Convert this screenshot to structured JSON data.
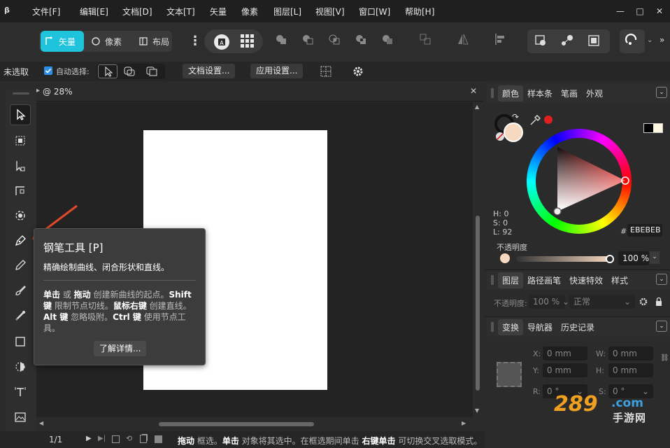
{
  "menubar": {
    "logo": "β",
    "items": [
      "文件[F]",
      "编辑[E]",
      "文档[D]",
      "文本[T]",
      "矢量",
      "像素",
      "图层[L]",
      "视图[V]",
      "窗口[W]",
      "帮助[H]"
    ],
    "minimize": "—",
    "maximize": "□",
    "close": "✕"
  },
  "toolbar": {
    "personas": {
      "vector": "矢量",
      "pixel": "像素",
      "layout": "布局"
    },
    "more": "⋮"
  },
  "contextbar": {
    "selection": "未选取",
    "auto_select_label": "自动选择:",
    "auto_select_checked": true,
    "doc_settings": "文档设置...",
    "app_settings": "应用设置..."
  },
  "document": {
    "tab_title": "@ 28%",
    "page_indicator": "1/1"
  },
  "tooltip": {
    "title": "钢笔工具 [P]",
    "subtitle": "精确绘制曲线、闭合形状和直线。",
    "line1_a": "单击",
    "line1_b": " 或 ",
    "line1_c": "拖动",
    "line1_d": " 创建新曲线的起点。",
    "line1_e": "Shift",
    "line2_a": "键",
    "line2_b": " 限制节点切线。",
    "line2_c": "鼠标右键",
    "line2_d": " 创建直线。",
    "line3_a": "Alt 键",
    "line3_b": " 忽略吸附。",
    "line3_c": "Ctrl 键",
    "line3_d": " 使用节点工",
    "line4": "具。",
    "learn_more": "了解详情..."
  },
  "color_panel": {
    "tabs": [
      "颜色",
      "样本条",
      "笔画",
      "外观"
    ],
    "h": "H: 0",
    "s": "S: 0",
    "l": "L: 92",
    "hex_label": "#:",
    "hex": "EBEBEB",
    "opacity_label": "不透明度",
    "opacity_value": "100 %",
    "fill_color": "#f7d9c0",
    "accent": "#e02020"
  },
  "layers_panel": {
    "tabs": [
      "图层",
      "路径画笔",
      "快速特效",
      "样式"
    ],
    "opacity_label": "不透明度:",
    "opacity_value": "100 %",
    "blend_mode": "正常"
  },
  "transform_panel": {
    "tabs": [
      "变换",
      "导航器",
      "历史记录"
    ],
    "x_label": "X:",
    "x_value": "0 mm",
    "y_label": "Y:",
    "y_value": "0 mm",
    "w_label": "W:",
    "w_value": "0 mm",
    "h_label": "H:",
    "h_value": "0 mm",
    "r_label": "R:",
    "r_value": "0 °",
    "s_label": "S:",
    "s_value": "0 °"
  },
  "statusbar": {
    "b1": "拖动",
    "t1": " 框选。",
    "b2": "单击",
    "t2": " 对象将其选中。在框选期间单击 ",
    "b3": "右键单击",
    "t3": " 可切换交叉选取模式。"
  },
  "watermark": {
    "text": "289",
    "sub": "手游网",
    "com": ".com"
  }
}
